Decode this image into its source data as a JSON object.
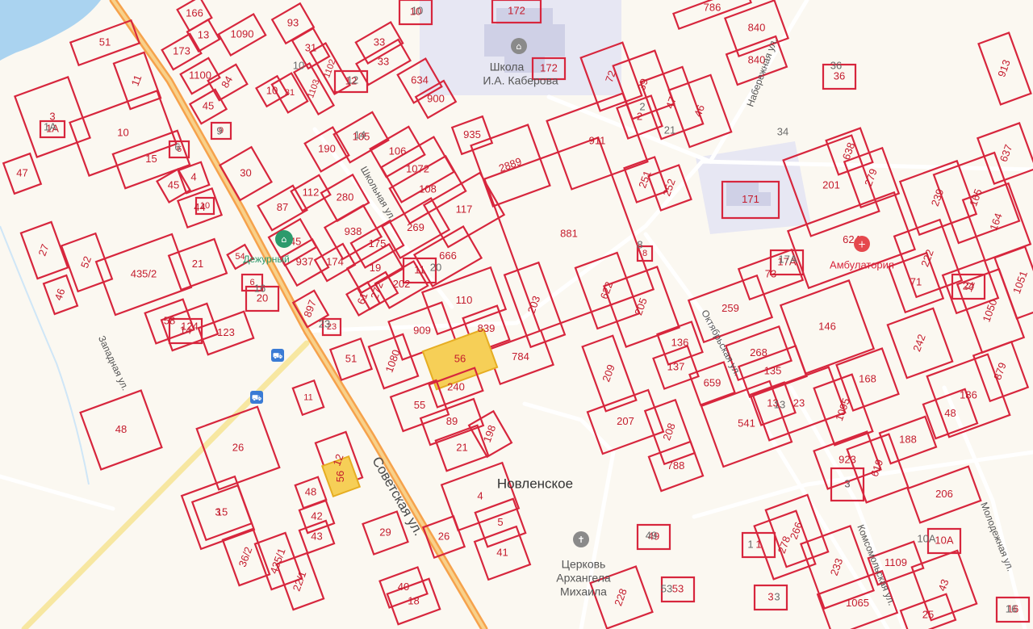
{
  "map": {
    "place_name": "Новленское",
    "streets": {
      "sovetskaya": "Советская ул.",
      "shkolnaya": "Школьная ул.",
      "naberezhnaya": "Набережная ул.",
      "oktyabrskaya": "Октябрьская ул.",
      "zapadnaya": "Западная ул.",
      "komsomolskaya": "Комсомольская ул.",
      "molodezhnaya": "Молодежная ул."
    },
    "pois": {
      "school_line1": "Школа",
      "school_line2": "И.А. Каберова",
      "clinic": "Амбулатория",
      "church_line1": "Церковь",
      "church_line2": "Архангела",
      "church_line3": "Михаила",
      "shop": "Дежурный"
    },
    "colors": {
      "parcel_outline": "#d7263d",
      "selected_parcel": "#f6cf57",
      "highlighted_parcel": "#f0a6b0",
      "water": "#aad3f0",
      "main_road": "#f6a24c",
      "background": "#fbf8f1"
    },
    "selected_parcel": "56",
    "highlighted_parcels": [
      "935",
      "2889"
    ],
    "parcel_numbers": [
      "166",
      "13",
      "173",
      "1090",
      "93",
      "31",
      "1100",
      "84",
      "1102",
      "1103",
      "31",
      "45",
      "10",
      "51",
      "11",
      "3",
      "1А",
      "10",
      "15",
      "6",
      "9",
      "30",
      "190",
      "47",
      "4",
      "45",
      "44",
      "10",
      "112",
      "87",
      "280",
      "245",
      "938",
      "937",
      "174",
      "175",
      "19",
      "27",
      "54",
      "52",
      "435/2",
      "21",
      "46",
      "58",
      "124",
      "123",
      "6",
      "897",
      "23",
      "51",
      "1080",
      "909",
      "110",
      "839",
      "784",
      "56",
      "240",
      "55",
      "89",
      "198",
      "21",
      "4",
      "5",
      "41",
      "26",
      "29",
      "3",
      "48",
      "26",
      "12",
      "56",
      "15",
      "48",
      "42",
      "43",
      "36/2",
      "435/1",
      "22/1",
      "40",
      "18",
      "228",
      "172",
      "172",
      "33",
      "33",
      "634",
      "900",
      "935",
      "2889",
      "10",
      "12",
      "105",
      "106",
      "1072",
      "108",
      "117",
      "269",
      "666",
      "202",
      "272",
      "61",
      "881",
      "203",
      "622",
      "205",
      "209",
      "207",
      "208",
      "788",
      "541",
      "659",
      "137",
      "136",
      "259",
      "268",
      "135",
      "23",
      "13",
      "146",
      "168",
      "1095",
      "188",
      "923",
      "619",
      "206",
      "266",
      "278",
      "233",
      "1065",
      "1109",
      "43",
      "25",
      "786",
      "840",
      "840",
      "72",
      "39",
      "47",
      "46",
      "2",
      "911",
      "251",
      "252",
      "8",
      "36",
      "171",
      "201",
      "638",
      "279",
      "239",
      "165",
      "637",
      "164",
      "624",
      "73",
      "71",
      "222",
      "11",
      "1050",
      "1051",
      "913",
      "242",
      "879",
      "186",
      "48",
      "3",
      "10А",
      "1",
      "49",
      "53",
      "3",
      "16",
      "17А",
      "14",
      "24",
      "11",
      "11",
      "20",
      "16"
    ],
    "house_numbers_gray": [
      "10",
      "12",
      "10",
      "1А",
      "6",
      "9",
      "14",
      "21",
      "20",
      "16",
      "23",
      "8",
      "17А",
      "13",
      "3",
      "1",
      "49",
      "53",
      "10А",
      "16",
      "36",
      "34",
      "2",
      "3"
    ]
  }
}
